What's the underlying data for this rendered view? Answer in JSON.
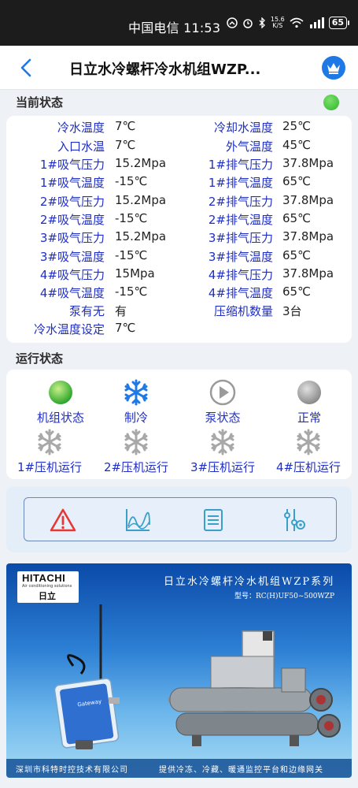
{
  "statusbar": {
    "carrier_time": "中国电信 11:53",
    "net_speed_top": "15.6",
    "net_speed_bottom": "K/S",
    "battery": "65"
  },
  "navbar": {
    "title": "日立水冷螺杆冷水机组WZP..."
  },
  "current_status": {
    "title": "当前状态",
    "indicator_color": "#2fb52a",
    "rows": [
      {
        "l_label": "冷水温度",
        "l_value": "7℃",
        "r_label": "冷却水温度",
        "r_value": "25℃"
      },
      {
        "l_label": "入口水温",
        "l_value": "7℃",
        "r_label": "外气温度",
        "r_value": "45℃"
      },
      {
        "l_label": "1#吸气压力",
        "l_value": "15.2Mpa",
        "r_label": "1#排气压力",
        "r_value": "37.8Mpa"
      },
      {
        "l_label": "1#吸气温度",
        "l_value": "-15℃",
        "r_label": "1#排气温度",
        "r_value": "65℃"
      },
      {
        "l_label": "2#吸气压力",
        "l_value": "15.2Mpa",
        "r_label": "2#排气压力",
        "r_value": "37.8Mpa"
      },
      {
        "l_label": "2#吸气温度",
        "l_value": "-15℃",
        "r_label": "2#排气温度",
        "r_value": "65℃"
      },
      {
        "l_label": "3#吸气压力",
        "l_value": "15.2Mpa",
        "r_label": "3#排气压力",
        "r_value": "37.8Mpa"
      },
      {
        "l_label": "3#吸气温度",
        "l_value": "-15℃",
        "r_label": "3#排气温度",
        "r_value": "65℃"
      },
      {
        "l_label": "4#吸气压力",
        "l_value": "15Mpa",
        "r_label": "4#排气压力",
        "r_value": "37.8Mpa"
      },
      {
        "l_label": "4#吸气温度",
        "l_value": "-15℃",
        "r_label": "4#排气温度",
        "r_value": "65℃"
      },
      {
        "l_label": "泵有无",
        "l_value": "有",
        "r_label": "压缩机数量",
        "r_value": "3台"
      },
      {
        "l_label": "冷水温度设定",
        "l_value": "7℃",
        "r_label": "",
        "r_value": ""
      }
    ]
  },
  "run_status": {
    "title": "运行状态",
    "items": [
      {
        "label": "机组状态",
        "icon": "green-circle-icon"
      },
      {
        "label": "制冷",
        "icon": "snowflake-blue-icon"
      },
      {
        "label": "泵状态",
        "icon": "play-circle-gray-icon"
      },
      {
        "label": "正常",
        "icon": "gray-circle-icon"
      },
      {
        "label": "1#压机运行",
        "icon": "snowflake-gray-icon"
      },
      {
        "label": "2#压机运行",
        "icon": "snowflake-gray-icon"
      },
      {
        "label": "3#压机运行",
        "icon": "snowflake-gray-icon"
      },
      {
        "label": "4#压机运行",
        "icon": "snowflake-gray-icon"
      }
    ]
  },
  "toolbar": {
    "buttons": [
      "alarm-warning-icon",
      "trend-chart-icon",
      "list-document-icon",
      "settings-sliders-icon"
    ]
  },
  "banner": {
    "brand": "HITACHI",
    "brand_sub": "Air conditioning solutions",
    "brand_cn": "日立",
    "title": "日立水冷螺杆冷水机组WZP系列",
    "model": "型号：RC(H)UF50~500WZP",
    "footer_left": "深圳市科特时控技术有限公司",
    "footer_right": "提供冷冻、冷藏、暖通监控平台和边缘网关",
    "device_label": "Gateway"
  }
}
